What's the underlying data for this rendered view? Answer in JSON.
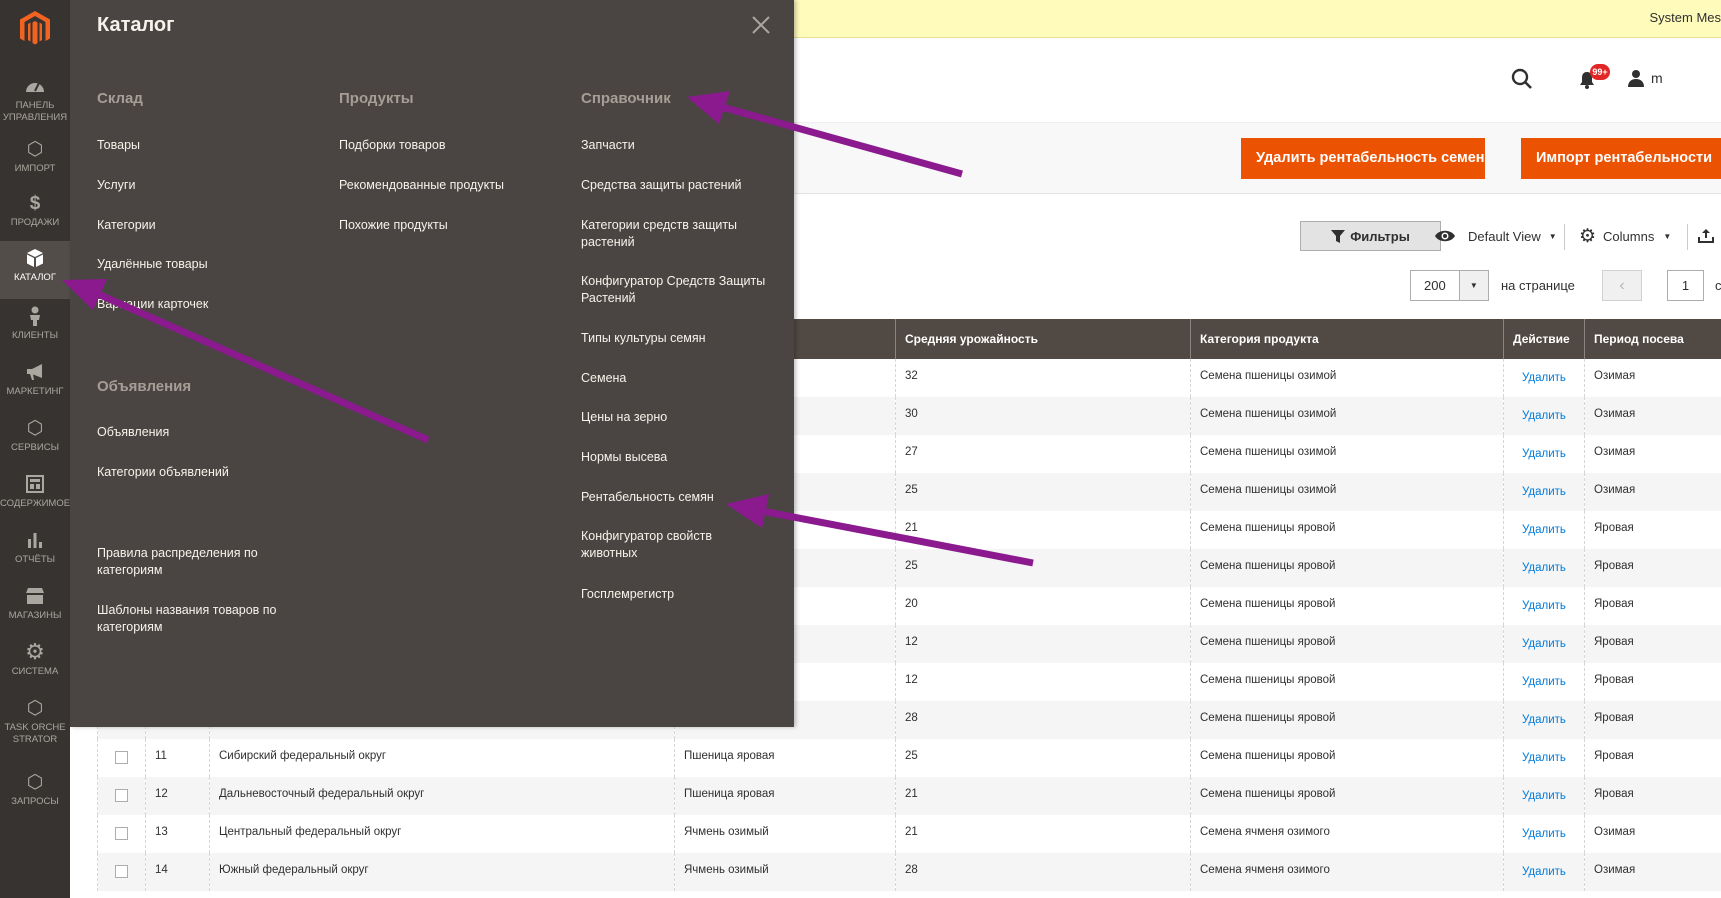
{
  "sidebar": {
    "items": [
      {
        "label": "Панель управления",
        "icon": "dashboard-icon"
      },
      {
        "label": "Импорт",
        "icon": "hexagon-icon"
      },
      {
        "label": "Продажи",
        "icon": "dollar-icon"
      },
      {
        "label": "Каталог",
        "icon": "box-icon"
      },
      {
        "label": "Клиенты",
        "icon": "person-icon"
      },
      {
        "label": "Маркетинг",
        "icon": "megaphone-icon"
      },
      {
        "label": "Сервисы",
        "icon": "hexagon-icon"
      },
      {
        "label": "Содержимое",
        "icon": "layout-icon"
      },
      {
        "label": "Отчёты",
        "icon": "bar-chart-icon"
      },
      {
        "label": "Магазины",
        "icon": "store-icon"
      },
      {
        "label": "Система",
        "icon": "gear-icon"
      },
      {
        "label": "Task Orchestrator",
        "icon": "hexagon-icon"
      },
      {
        "label": "Запросы",
        "icon": "hexagon-icon"
      }
    ]
  },
  "system_messages": {
    "label": "System Mes"
  },
  "header": {
    "notifications_count": "99+",
    "user_initial": "m"
  },
  "actions": {
    "delete_label": "Удалить рентабельность семен",
    "import_label": "Импорт рентабельности"
  },
  "toolbar": {
    "filters_label": "Фильтры",
    "view_label": "Default View",
    "columns_label": "Columns",
    "per_page_value": "200",
    "per_page_label": "на странице",
    "page_value": "1",
    "page_of": "с"
  },
  "grid": {
    "columns": [
      "",
      "",
      "",
      "",
      "Средняя урожайность",
      "Категория продукта",
      "Действие",
      "Период посева"
    ],
    "delete_label": "Удалить",
    "rows": [
      {
        "id": "",
        "region": "",
        "crop": "",
        "yield": "32",
        "category": "Семена пшеницы озимой",
        "period": "Озимая"
      },
      {
        "id": "",
        "region": "",
        "crop": "",
        "yield": "30",
        "category": "Семена пшеницы озимой",
        "period": "Озимая"
      },
      {
        "id": "",
        "region": "",
        "crop": "",
        "yield": "27",
        "category": "Семена пшеницы озимой",
        "period": "Озимая"
      },
      {
        "id": "",
        "region": "",
        "crop": "",
        "yield": "25",
        "category": "Семена пшеницы озимой",
        "period": "Озимая"
      },
      {
        "id": "",
        "region": "",
        "crop": "",
        "yield": "21",
        "category": "Семена пшеницы яровой",
        "period": "Яровая"
      },
      {
        "id": "",
        "region": "",
        "crop": "",
        "yield": "25",
        "category": "Семена пшеницы яровой",
        "period": "Яровая"
      },
      {
        "id": "",
        "region": "",
        "crop": "",
        "yield": "20",
        "category": "Семена пшеницы яровой",
        "period": "Яровая"
      },
      {
        "id": "",
        "region": "",
        "crop": "",
        "yield": "12",
        "category": "Семена пшеницы яровой",
        "period": "Яровая"
      },
      {
        "id": "",
        "region": "",
        "crop": "",
        "yield": "12",
        "category": "Семена пшеницы яровой",
        "period": "Яровая"
      },
      {
        "id": "",
        "region": "",
        "crop": "",
        "yield": "28",
        "category": "Семена пшеницы яровой",
        "period": "Яровая"
      },
      {
        "id": "11",
        "region": "Сибирский федеральный округ",
        "crop": "Пшеница яровая",
        "yield": "25",
        "category": "Семена пшеницы яровой",
        "period": "Яровая"
      },
      {
        "id": "12",
        "region": "Дальневосточный федеральный округ",
        "crop": "Пшеница яровая",
        "yield": "21",
        "category": "Семена пшеницы яровой",
        "period": "Яровая"
      },
      {
        "id": "13",
        "region": "Центральный федеральный округ",
        "crop": "Ячмень озимый",
        "yield": "21",
        "category": "Семена ячменя озимого",
        "period": "Озимая"
      },
      {
        "id": "14",
        "region": "Южный федеральный округ",
        "crop": "Ячмень озимый",
        "yield": "28",
        "category": "Семена ячменя озимого",
        "period": "Озимая"
      }
    ]
  },
  "catalog_menu": {
    "title": "Каталог",
    "sklad": {
      "title": "Склад",
      "items": [
        "Товары",
        "Услуги",
        "Категории",
        "Удалённые товары",
        "Вариации карточек"
      ]
    },
    "announcements": {
      "title": "Объявления",
      "items": [
        "Объявления",
        "Категории объявлений"
      ]
    },
    "extra": {
      "items": [
        "Правила распределения по категориям",
        "Шаблоны названия товаров по категориям"
      ]
    },
    "products": {
      "title": "Продукты",
      "items": [
        "Подборки товаров",
        "Рекомендованные продукты",
        "Похожие продукты"
      ]
    },
    "reference": {
      "title": "Справочник",
      "items": [
        "Запчасти",
        "Средства защиты растений",
        "Категории средств защиты растений",
        "Конфигуратор Средств Защиты Растений",
        "Типы культуры семян",
        "Семена",
        "Цены на зерно",
        "Нормы высева",
        "Рентабельность семян",
        "Конфигуратор свойств животных",
        "Госплемрегистр"
      ]
    }
  },
  "annotation_color": "#8b1a8f"
}
